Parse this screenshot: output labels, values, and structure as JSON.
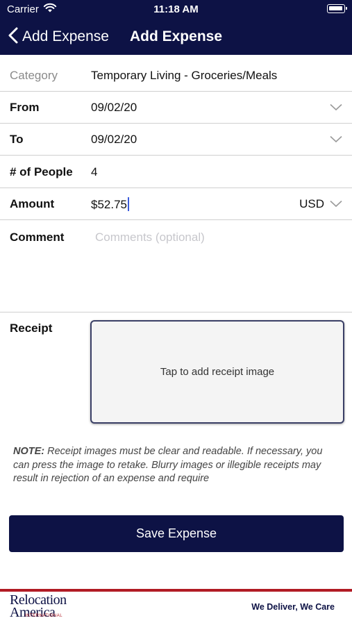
{
  "status_bar": {
    "carrier": "Carrier",
    "time": "11:18 AM"
  },
  "nav": {
    "back_label": "Add Expense",
    "title": "Add Expense"
  },
  "form": {
    "category": {
      "label": "Category",
      "value": "Temporary Living - Groceries/Meals"
    },
    "from": {
      "label": "From",
      "value": "09/02/20"
    },
    "to": {
      "label": "To",
      "value": "09/02/20"
    },
    "people": {
      "label": "# of People",
      "value": "4"
    },
    "amount": {
      "label": "Amount",
      "symbol": "$",
      "value": "52.75",
      "currency": "USD"
    },
    "comment": {
      "label": "Comment",
      "placeholder": "Comments (optional)",
      "value": ""
    }
  },
  "receipt": {
    "label": "Receipt",
    "prompt": "Tap to add receipt image"
  },
  "note": {
    "prefix": "NOTE:",
    "text": "Receipt images must be clear and readable. If necessary, you can press the image to retake. Blurry images or illegible receipts may result in rejection of an expense and require"
  },
  "save_button": "Save Expense",
  "footer": {
    "logo_line1": "Relocation",
    "logo_line2": "America",
    "logo_line3": "INTERNATIONAL",
    "tagline": "We Deliver, We Care"
  },
  "colors": {
    "primary": "#0d1245",
    "accent_red": "#b11b24",
    "divider": "#cfcfcf",
    "caret": "#3b5bdb"
  }
}
